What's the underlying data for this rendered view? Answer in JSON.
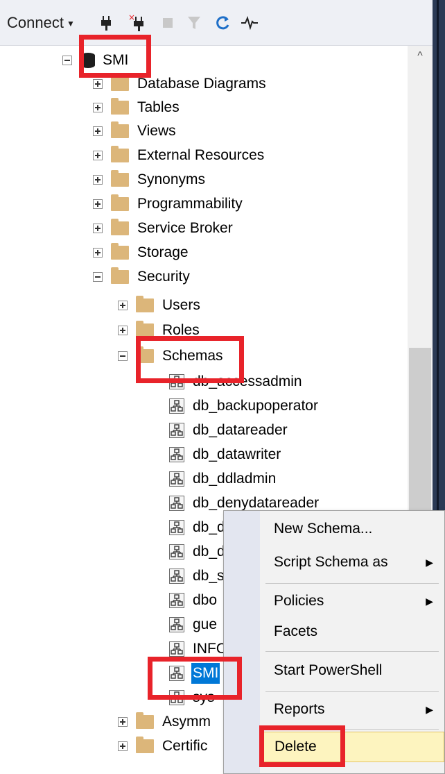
{
  "toolbar": {
    "connect_label": "Connect",
    "icons": [
      "connect-plug-icon",
      "disconnect-plug-icon",
      "stop-icon",
      "filter-icon",
      "refresh-icon",
      "activity-monitor-icon"
    ]
  },
  "tree": {
    "root": "SMI",
    "db_children": [
      "Database Diagrams",
      "Tables",
      "Views",
      "External Resources",
      "Synonyms",
      "Programmability",
      "Service Broker",
      "Storage",
      "Security"
    ],
    "security_children": [
      "Users",
      "Roles",
      "Schemas"
    ],
    "schemas": [
      "db_accessadmin",
      "db_backupoperator",
      "db_datareader",
      "db_datawriter",
      "db_ddladmin",
      "db_denydatareader",
      "db_d",
      "db_d",
      "db_s",
      "dbo",
      "gue",
      "INFO",
      "SMI",
      "sys"
    ],
    "bottom_children": [
      "Asymm",
      "Certific"
    ]
  },
  "context_menu": {
    "items": [
      "New Schema...",
      "Script Schema as",
      "Policies",
      "Facets",
      "Start PowerShell",
      "Reports",
      "Delete"
    ]
  },
  "colors": {
    "selection": "#0078d7",
    "annotation": "#e8232a",
    "folder": "#dcb67a",
    "menu_highlight": "#fdf4bf"
  }
}
